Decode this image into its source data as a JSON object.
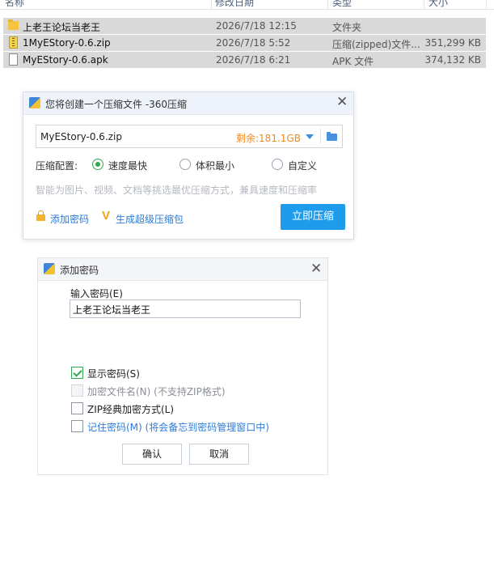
{
  "file_list": {
    "headers": {
      "name": "名称",
      "modified": "修改日期",
      "type": "类型",
      "size": "大小"
    },
    "rows": [
      {
        "icon": "folder-icon",
        "name": "上老王论坛当老王",
        "modified": "2026/7/18 12:15",
        "type": "文件夹",
        "size": ""
      },
      {
        "icon": "zip-archive-icon",
        "name": "1MyEStory-0.6.zip",
        "modified": "2026/7/18 5:52",
        "type": "压缩(zipped)文件...",
        "size": "351,299 KB"
      },
      {
        "icon": "file-icon",
        "name": "MyEStory-0.6.apk",
        "modified": "2026/7/18 6:21",
        "type": "APK 文件",
        "size": "374,132 KB"
      }
    ]
  },
  "compress_dialog": {
    "title": "您将创建一个压缩文件 -360压缩",
    "close_symbol": "✕",
    "filename": "MyEStory-0.6.zip",
    "remaining_space": "剩余:181.1GB",
    "config_label": "压缩配置:",
    "options": [
      {
        "label": "速度最快",
        "selected": true
      },
      {
        "label": "体积最小",
        "selected": false
      },
      {
        "label": "自定义",
        "selected": false
      }
    ],
    "hint": "智能为图片、视频、文档等挑选最优压缩方式，兼具速度和压缩率",
    "add_password_link": "添加密码",
    "super_compress_link": "生成超级压缩包",
    "super_compress_mark": "V",
    "compress_button": "立即压缩",
    "accent_color": "#1e9bea",
    "space_color": "#f08a1d"
  },
  "password_dialog": {
    "title": "添加密码",
    "close_symbol": "✕",
    "input_label": "输入密码(E)",
    "password_value": "上老王论坛当老王",
    "checkboxes": [
      {
        "label": "显示密码(S)",
        "checked": true,
        "disabled": false
      },
      {
        "label": "加密文件名(N) (不支持ZIP格式)",
        "checked": false,
        "disabled": true
      },
      {
        "label": "ZIP经典加密方式(L)",
        "checked": false,
        "disabled": false
      },
      {
        "label": "记住密码(M) (将会备忘到密码管理窗口中)",
        "checked": false,
        "disabled": false
      }
    ],
    "ok_button": "确认",
    "cancel_button": "取消",
    "check_color": "#2fa84f"
  }
}
